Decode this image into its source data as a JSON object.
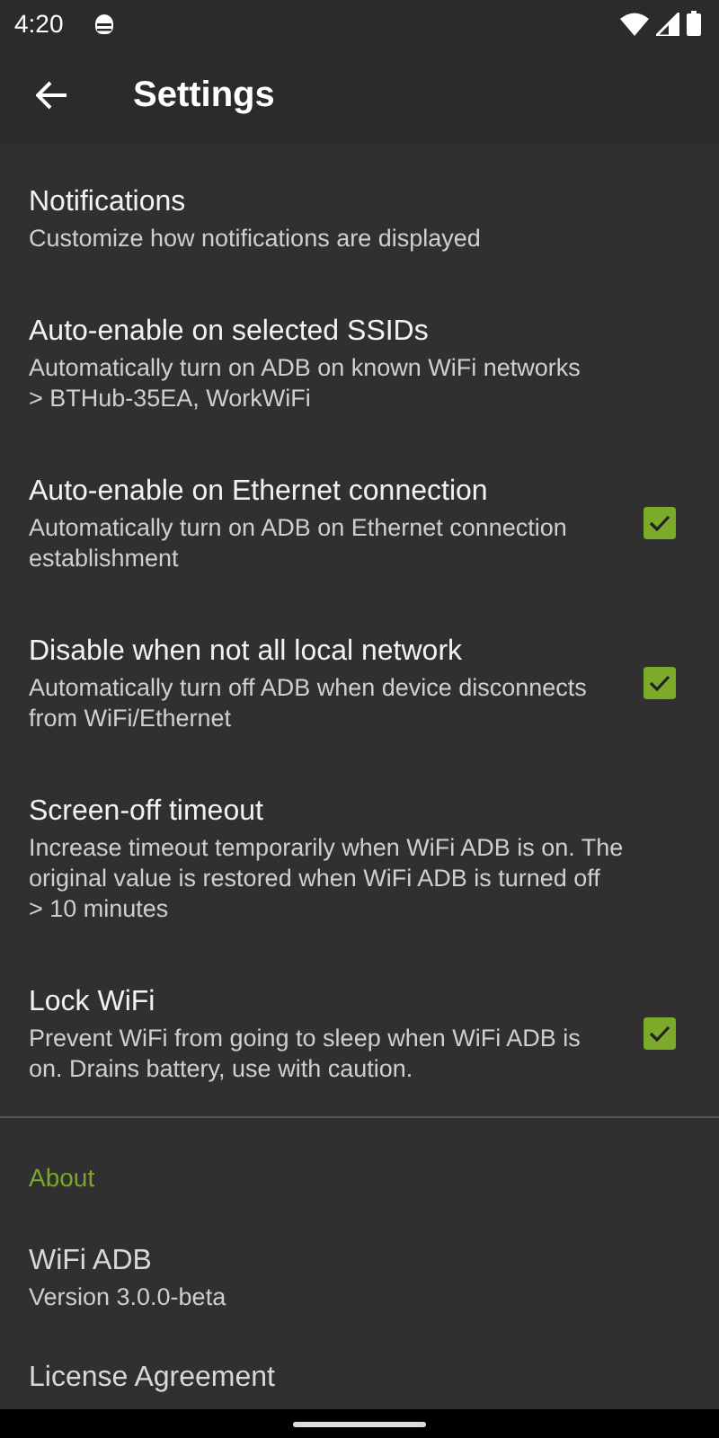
{
  "status_bar": {
    "time": "4:20"
  },
  "app_bar": {
    "title": "Settings"
  },
  "items": [
    {
      "kind": "plain",
      "title": "Notifications",
      "summary": "Customize how notifications are displayed"
    },
    {
      "kind": "plain",
      "title": "Auto-enable on selected SSIDs",
      "summary": "Automatically turn on ADB on known WiFi networks",
      "value": "> BTHub-35EA, WorkWiFi"
    },
    {
      "kind": "checkbox",
      "title": "Auto-enable on Ethernet connection",
      "summary": "Automatically turn on ADB on Ethernet connection establishment",
      "checked": true
    },
    {
      "kind": "checkbox",
      "title": "Disable when not all local network",
      "summary": "Automatically turn off ADB when device disconnects from WiFi/Ethernet",
      "checked": true
    },
    {
      "kind": "plain",
      "title": "Screen-off timeout",
      "summary": "Increase timeout temporarily when WiFi ADB is on. The original value is restored when WiFi ADB is turned off",
      "value": "> 10 minutes"
    },
    {
      "kind": "checkbox",
      "title": "Lock WiFi",
      "summary": "Prevent WiFi from going to sleep when WiFi ADB is on. Drains battery, use with caution.",
      "checked": true
    }
  ],
  "about": {
    "header": "About",
    "items": [
      {
        "title": "WiFi ADB",
        "summary": "Version 3.0.0-beta"
      },
      {
        "title": "License Agreement"
      }
    ]
  }
}
